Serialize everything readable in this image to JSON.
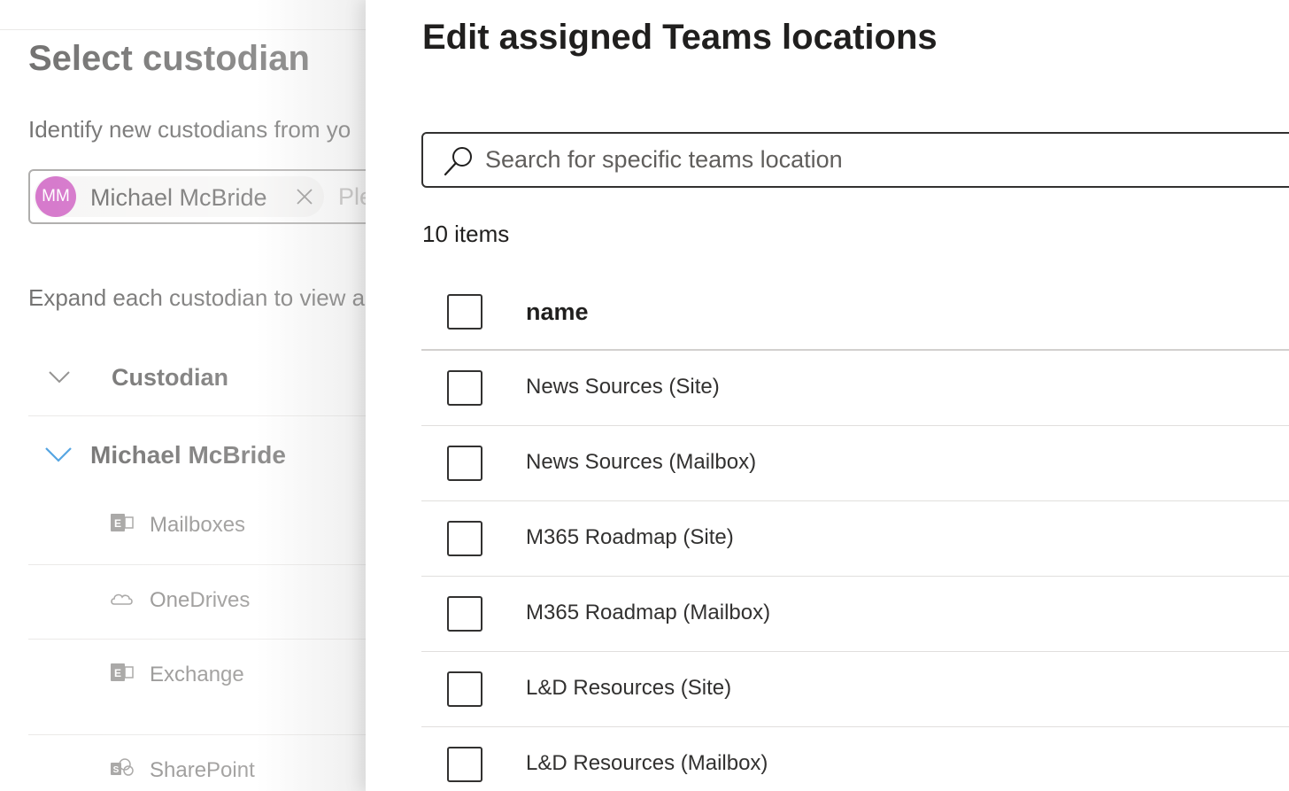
{
  "background": {
    "title": "Select custodian",
    "description": "Identify new custodians from yo",
    "picker": {
      "avatar_initials": "MM",
      "selected_name": "Michael McBride",
      "placeholder_partial": "Ple"
    },
    "description2": "Expand each custodian to view a",
    "column_header": "Custodian",
    "custodian": {
      "name": "Michael McBride",
      "sources": [
        {
          "label": "Mailboxes",
          "icon": "exchange-icon"
        },
        {
          "label": "OneDrives",
          "icon": "cloud-icon"
        },
        {
          "label": "Exchange",
          "icon": "exchange-icon"
        },
        {
          "label": "SharePoint",
          "icon": "sharepoint-icon"
        }
      ]
    },
    "colors": {
      "avatar": "#c239b3",
      "chevron_accent": "#0078d4"
    }
  },
  "panel": {
    "title": "Edit assigned Teams locations",
    "search_placeholder": "Search for specific teams location",
    "item_count": "10 items",
    "column_name": "name",
    "rows": [
      {
        "name": "News Sources (Site)"
      },
      {
        "name": "News Sources (Mailbox)"
      },
      {
        "name": "M365 Roadmap (Site)"
      },
      {
        "name": "M365 Roadmap (Mailbox)"
      },
      {
        "name": "L&D Resources (Site)"
      },
      {
        "name": "L&D Resources (Mailbox)"
      }
    ]
  }
}
